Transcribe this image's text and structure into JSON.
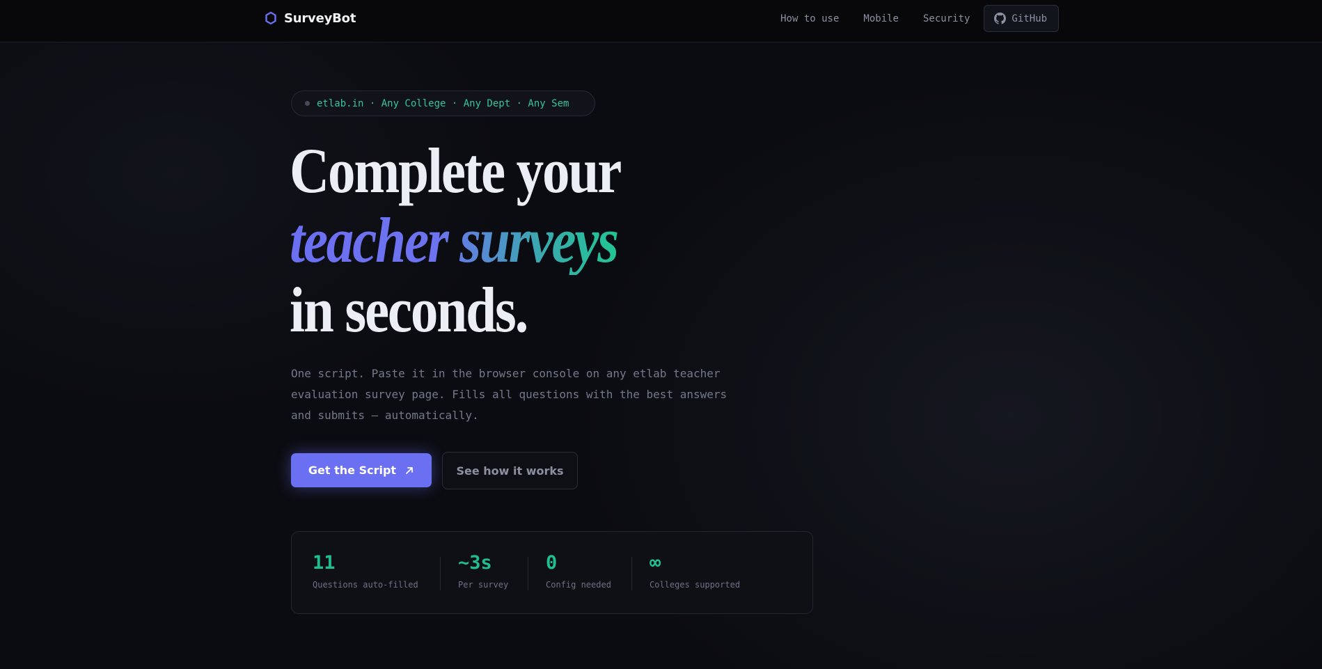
{
  "nav": {
    "brand": "SurveyBot",
    "links": [
      "How to use",
      "Mobile",
      "Security"
    ],
    "github_label": "GitHub"
  },
  "hero": {
    "tag": "etlab.in · Any College · Any Dept · Any Sem",
    "headline_line1": "Complete your",
    "headline_line2": "teacher surveys",
    "headline_line3": "in seconds.",
    "subtext": "One script. Paste it in the browser console on any etlab teacher evaluation survey page. Fills all questions with the best answers and submits — automatically.",
    "primary_button": "Get the Script",
    "secondary_button": "See how it works"
  },
  "stats": [
    {
      "value": "11",
      "label": "Questions auto-filled"
    },
    {
      "value": "~3s",
      "label": "Per survey"
    },
    {
      "value": "0",
      "label": "Config needed"
    },
    {
      "value": "∞",
      "label": "Colleges supported"
    }
  ],
  "colors": {
    "accent": "#6b6ff2",
    "green": "#1fbf8e",
    "background": "#0b0c11"
  }
}
